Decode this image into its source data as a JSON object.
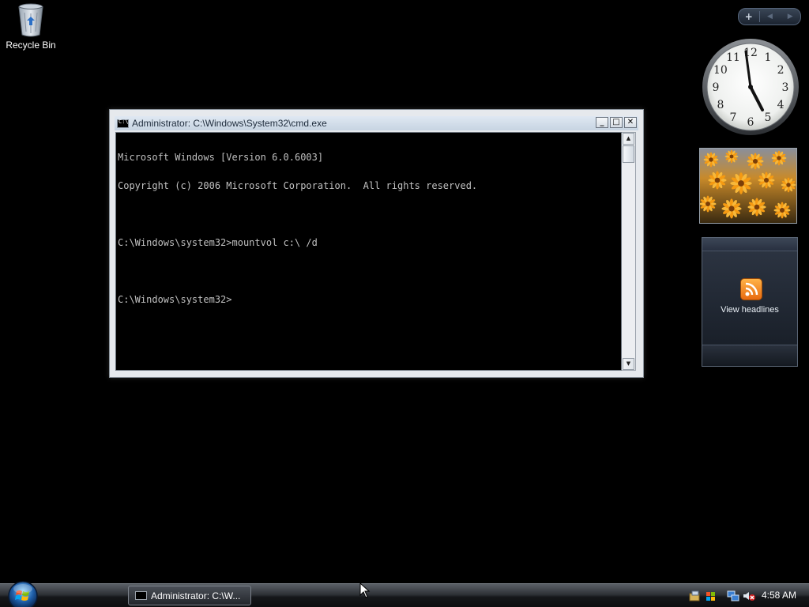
{
  "desktop": {
    "icons": [
      {
        "label": "Recycle Bin",
        "icon": "recycle-bin-icon"
      }
    ]
  },
  "sidebar": {
    "controls": {
      "add": "+",
      "prev": "◀",
      "next": "▶"
    },
    "clock": {
      "hour_numbers": [
        "12",
        "1",
        "2",
        "3",
        "4",
        "5",
        "6",
        "7",
        "8",
        "9",
        "10",
        "11"
      ],
      "time_shown": "4:58"
    },
    "slideshow": {
      "subject": "orange daisy flowers"
    },
    "feeds": {
      "label": "View headlines",
      "icon": "rss-icon"
    }
  },
  "cmd_window": {
    "title": "Administrator: C:\\Windows\\System32\\cmd.exe",
    "buttons": {
      "minimize": "_",
      "maximize": "□",
      "close": "✕"
    },
    "lines": [
      "Microsoft Windows [Version 6.0.6003]",
      "Copyright (c) 2006 Microsoft Corporation.  All rights reserved.",
      "",
      "C:\\Windows\\system32>mountvol c:\\ /d",
      "",
      "C:\\Windows\\system32>"
    ],
    "scroll_up": "▲",
    "scroll_down": "▼"
  },
  "taskbar": {
    "task_label": "Administrator: C:\\W...",
    "tray_time": "4:58 AM",
    "tray_icons": [
      "network-folder-icon",
      "windows-flag-icon",
      "network-icon",
      "volume-muted-icon"
    ]
  }
}
